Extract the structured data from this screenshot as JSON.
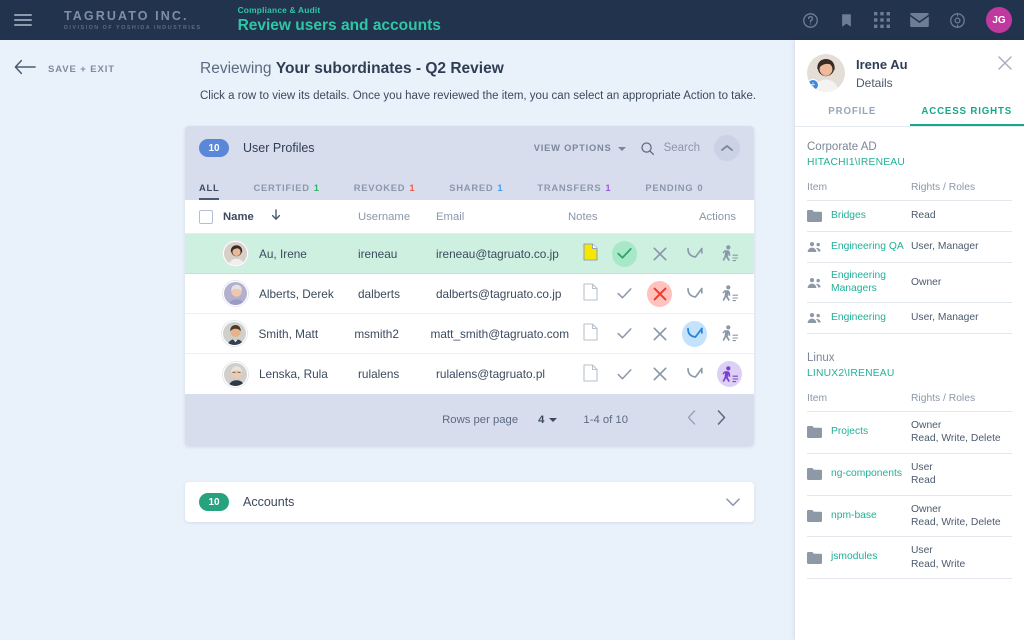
{
  "topbar": {
    "menu_icon": "hamburger-menu-icon",
    "brand_name": "TAGRUATO INC.",
    "brand_sub": "DIVISION OF YOSHIDA INDUSTRIES",
    "context_label": "Compliance & Audit",
    "context_title": "Review users and accounts",
    "icons": [
      "help-icon",
      "bookmark-icon",
      "apps-grid-icon",
      "mail-icon",
      "settings-gear-icon"
    ],
    "user_initials": "JG",
    "accent_color": "#2ec7a6",
    "bar_color": "#22334d",
    "avatar_color": "#c0399f"
  },
  "subheader": {
    "back_label": "SAVE + EXIT",
    "title_prefix": "Reviewing ",
    "title_strong": "Your subordinates - Q2 Review",
    "description": "Click a row to view its details. Once you have reviewed the item, you can select an appropriate Action to take."
  },
  "profiles_card": {
    "badge": "10",
    "title": "User Profiles",
    "view_options": "VIEW OPTIONS",
    "search_placeholder": "Search",
    "collapse_icon": "chevron-up-icon",
    "badge_color": "#5a87d8",
    "tabs": [
      {
        "label": "ALL",
        "count": "",
        "count_color": "gray",
        "active": true
      },
      {
        "label": "CERTIFIED",
        "count": "1",
        "count_color": "green",
        "active": false
      },
      {
        "label": "REVOKED",
        "count": "1",
        "count_color": "red",
        "active": false
      },
      {
        "label": "SHARED",
        "count": "1",
        "count_color": "blue",
        "active": false
      },
      {
        "label": "TRANSFERS",
        "count": "1",
        "count_color": "purple",
        "active": false
      },
      {
        "label": "PENDING",
        "count": "0",
        "count_color": "gray",
        "active": false
      }
    ],
    "columns": {
      "name": "Name",
      "username": "Username",
      "email": "Email",
      "notes": "Notes",
      "actions": "Actions",
      "sort_icon": "sort-descending-arrow-icon"
    },
    "rows": [
      {
        "name": "Au, Irene",
        "username": "ireneau",
        "email": "ireneau@tagruato.co.jp",
        "note": "filled",
        "selected": true,
        "action_state": "certify"
      },
      {
        "name": "Alberts, Derek",
        "username": "dalberts",
        "email": "dalberts@tagruato.co.jp",
        "note": "empty",
        "selected": false,
        "action_state": "revoke"
      },
      {
        "name": "Smith, Matt",
        "username": "msmith2",
        "email": "matt_smith@tagruato.com",
        "note": "empty",
        "selected": false,
        "action_state": "transfer"
      },
      {
        "name": "Lenska, Rula",
        "username": "rulalens",
        "email": "rulalens@tagruato.pl",
        "note": "empty",
        "selected": false,
        "action_state": "share"
      }
    ],
    "pager": {
      "rows_per_page_label": "Rows per page",
      "rows_per_page_value": "4",
      "range": "1-4 of 10",
      "prev_icon": "chevron-left-icon",
      "next_icon": "chevron-right-icon"
    }
  },
  "accounts_card": {
    "badge": "10",
    "title": "Accounts",
    "expand_icon": "chevron-down-icon",
    "badge_color": "#26a37e"
  },
  "details_panel": {
    "user_name": "Irene Au",
    "subtitle": "Details",
    "close_icon": "close-icon",
    "tabs": [
      {
        "label": "PROFILE",
        "active": false
      },
      {
        "label": "ACCESS RIGHTS",
        "active": true
      }
    ],
    "accent_color": "#17a88c",
    "groups": [
      {
        "title": "Corporate AD",
        "account": "HITACHI1\\IRENEAU",
        "col_item": "Item",
        "col_rights": "Rights / Roles",
        "rows": [
          {
            "icon": "folder-icon",
            "item": "Bridges",
            "rights": "Read"
          },
          {
            "icon": "group-icon",
            "item": "Engineering QA",
            "rights": "User, Manager"
          },
          {
            "icon": "group-icon",
            "item": "Engineering Managers",
            "rights": "Owner"
          },
          {
            "icon": "group-icon",
            "item": "Engineering",
            "rights": "User, Manager"
          }
        ]
      },
      {
        "title": "Linux",
        "account": "LINUX2\\IRENEAU",
        "col_item": "Item",
        "col_rights": "Rights / Roles",
        "rows": [
          {
            "icon": "folder-icon",
            "item": "Projects",
            "rights": "Owner\nRead, Write, Delete"
          },
          {
            "icon": "folder-icon",
            "item": "ng-components",
            "rights": "User\nRead"
          },
          {
            "icon": "folder-icon",
            "item": "npm-base",
            "rights": "Owner\nRead, Write, Delete"
          },
          {
            "icon": "folder-icon",
            "item": "jsmodules",
            "rights": "User\nRead, Write"
          }
        ]
      }
    ]
  },
  "action_icons": {
    "certify": "check-icon",
    "revoke": "x-icon",
    "transfer": "arrow-transfer-icon",
    "share": "person-share-icon"
  }
}
